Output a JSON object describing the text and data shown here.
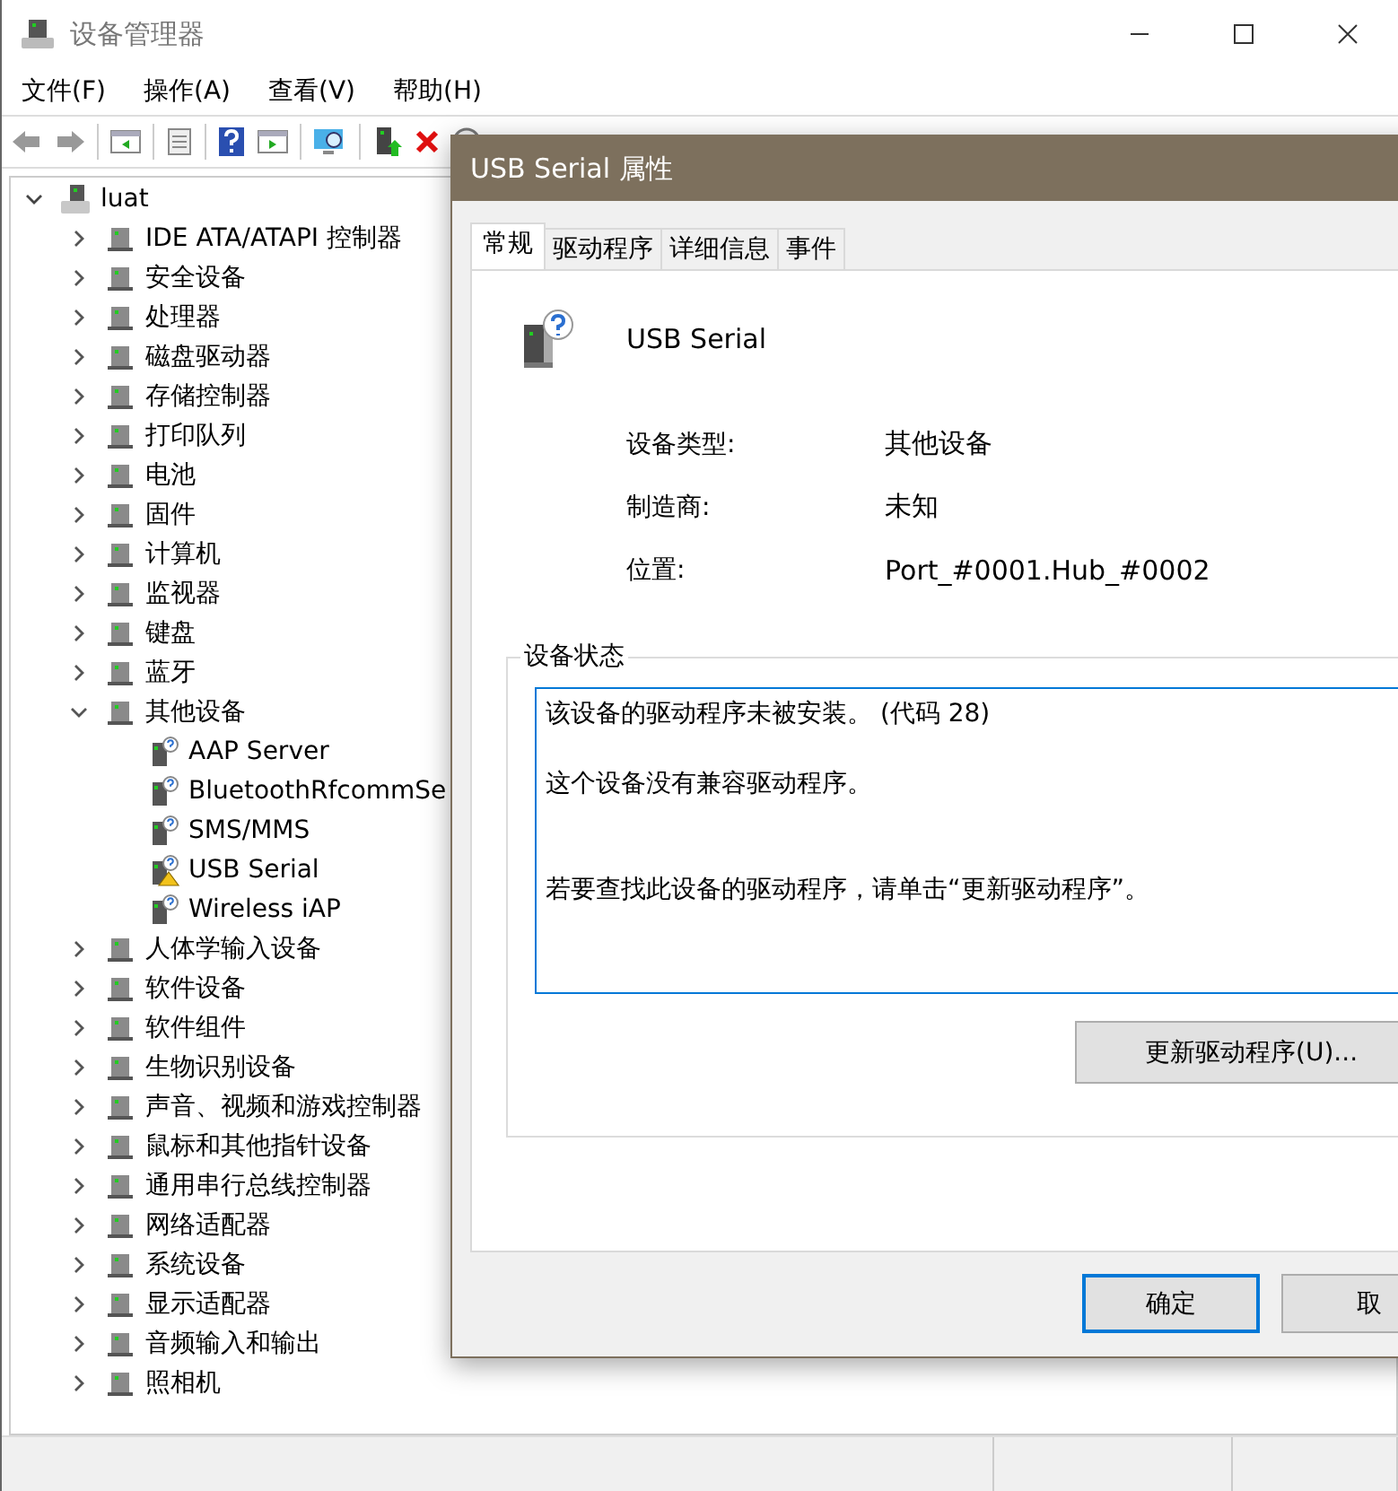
{
  "window": {
    "title": "设备管理器"
  },
  "menu": [
    "文件(F)",
    "操作(A)",
    "查看(V)",
    "帮助(H)"
  ],
  "tree": {
    "label": "luat",
    "expanded": true,
    "children": [
      {
        "label": "IDE ATA/ATAPI 控制器",
        "expanded": false
      },
      {
        "label": "安全设备",
        "expanded": false
      },
      {
        "label": "处理器",
        "expanded": false
      },
      {
        "label": "磁盘驱动器",
        "expanded": false
      },
      {
        "label": "存储控制器",
        "expanded": false
      },
      {
        "label": "打印队列",
        "expanded": false
      },
      {
        "label": "电池",
        "expanded": false
      },
      {
        "label": "固件",
        "expanded": false
      },
      {
        "label": "计算机",
        "expanded": false
      },
      {
        "label": "监视器",
        "expanded": false
      },
      {
        "label": "键盘",
        "expanded": false
      },
      {
        "label": "蓝牙",
        "expanded": false
      },
      {
        "label": "其他设备",
        "expanded": true,
        "children": [
          {
            "label": "AAP Server",
            "warning": false
          },
          {
            "label": "BluetoothRfcommSe",
            "warning": false
          },
          {
            "label": "SMS/MMS",
            "warning": false
          },
          {
            "label": "USB Serial",
            "warning": true
          },
          {
            "label": "Wireless iAP",
            "warning": false
          }
        ]
      },
      {
        "label": "人体学输入设备",
        "expanded": false
      },
      {
        "label": "软件设备",
        "expanded": false
      },
      {
        "label": "软件组件",
        "expanded": false
      },
      {
        "label": "生物识别设备",
        "expanded": false
      },
      {
        "label": "声音、视频和游戏控制器",
        "expanded": false
      },
      {
        "label": "鼠标和其他指针设备",
        "expanded": false
      },
      {
        "label": "通用串行总线控制器",
        "expanded": false
      },
      {
        "label": "网络适配器",
        "expanded": false
      },
      {
        "label": "系统设备",
        "expanded": false
      },
      {
        "label": "显示适配器",
        "expanded": false
      },
      {
        "label": "音频输入和输出",
        "expanded": false
      },
      {
        "label": "照相机",
        "expanded": false
      }
    ]
  },
  "dialog": {
    "title": "USB Serial 属性",
    "tabs": [
      {
        "label": "常规",
        "selected": true
      },
      {
        "label": "驱动程序",
        "selected": false
      },
      {
        "label": "详细信息",
        "selected": false
      },
      {
        "label": "事件",
        "selected": false
      }
    ],
    "device_name": "USB Serial",
    "properties": [
      {
        "label": "设备类型:",
        "value": "其他设备"
      },
      {
        "label": "制造商:",
        "value": "未知"
      },
      {
        "label": "位置:",
        "value": "Port_#0001.Hub_#0002"
      }
    ],
    "status_group": {
      "title": "设备状态",
      "lines": [
        "该设备的驱动程序未被安装。 (代码 28)",
        "这个设备没有兼容驱动程序。",
        "若要查找此设备的驱动程序，请单击“更新驱动程序”。"
      ]
    },
    "update_button": "更新驱动程序(U)...",
    "buttons": [
      {
        "label": "确定",
        "default": true
      },
      {
        "label": "取",
        "default": false
      }
    ]
  }
}
